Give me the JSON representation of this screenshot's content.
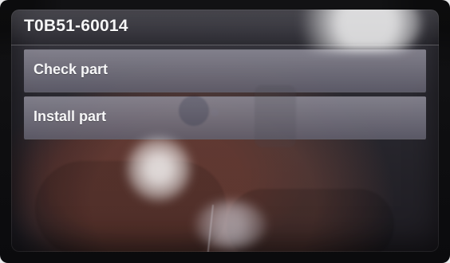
{
  "window": {
    "title": "T0B51-60014"
  },
  "menu": {
    "items": [
      {
        "label": "Check part"
      },
      {
        "label": "Install part"
      }
    ]
  },
  "theme": {
    "bezel": "#0b0b0d",
    "screen_bg": "#2a2930",
    "menu_item": "#7a7886",
    "text": "#f6f6f7"
  }
}
